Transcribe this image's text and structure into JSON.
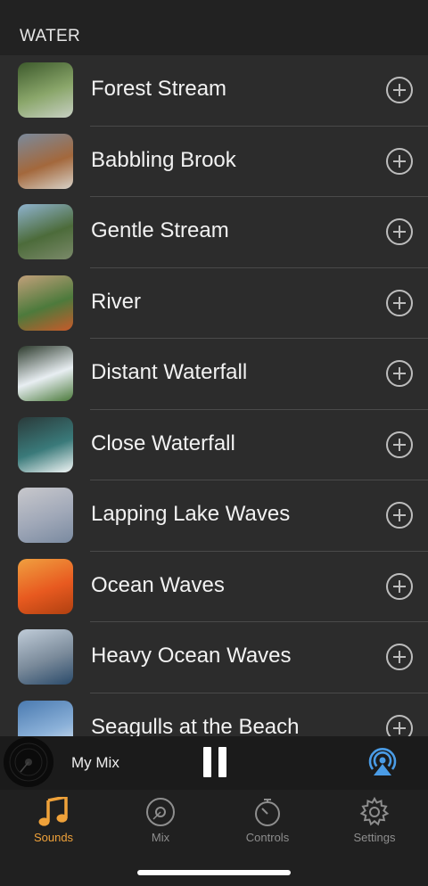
{
  "section": {
    "title": "WATER"
  },
  "sounds": [
    {
      "label": "Forest Stream",
      "thumb": [
        "#3d5a2c",
        "#8aa66a",
        "#c8d0c4"
      ]
    },
    {
      "label": "Babbling Brook",
      "thumb": [
        "#7a8a9c",
        "#a3683c",
        "#d8d2c8"
      ]
    },
    {
      "label": "Gentle Stream",
      "thumb": [
        "#8fb3cf",
        "#4c6b3a",
        "#7b8a6a"
      ]
    },
    {
      "label": "River",
      "thumb": [
        "#c2a07a",
        "#4d7a3c",
        "#c85a2a"
      ]
    },
    {
      "label": "Distant Waterfall",
      "thumb": [
        "#2c3a2c",
        "#e8eef2",
        "#4a7a3a"
      ]
    },
    {
      "label": "Close Waterfall",
      "thumb": [
        "#2a3a3a",
        "#3a7a7a",
        "#f2f6f6"
      ]
    },
    {
      "label": "Lapping Lake Waves",
      "thumb": [
        "#c8c8cc",
        "#a0a8b8",
        "#7a8aa0"
      ]
    },
    {
      "label": "Ocean Waves",
      "thumb": [
        "#f0a040",
        "#e85a20",
        "#b04010"
      ]
    },
    {
      "label": "Heavy Ocean Waves",
      "thumb": [
        "#c0ccd8",
        "#7a8a9a",
        "#2a4a6a"
      ]
    },
    {
      "label": "Seagulls at the Beach",
      "thumb": [
        "#4a7ab0",
        "#8ab0d8",
        "#e6ecf2"
      ]
    }
  ],
  "now_playing": {
    "title": "My Mix"
  },
  "tabs": [
    {
      "label": "Sounds",
      "icon": "music-note-icon",
      "active": true
    },
    {
      "label": "Mix",
      "icon": "disc-icon",
      "active": false
    },
    {
      "label": "Controls",
      "icon": "stopwatch-icon",
      "active": false
    },
    {
      "label": "Settings",
      "icon": "gear-icon",
      "active": false
    }
  ],
  "colors": {
    "accent": "#f0a23a",
    "airplay": "#4a9ce6",
    "inactive_tab": "#8e8e8e"
  }
}
